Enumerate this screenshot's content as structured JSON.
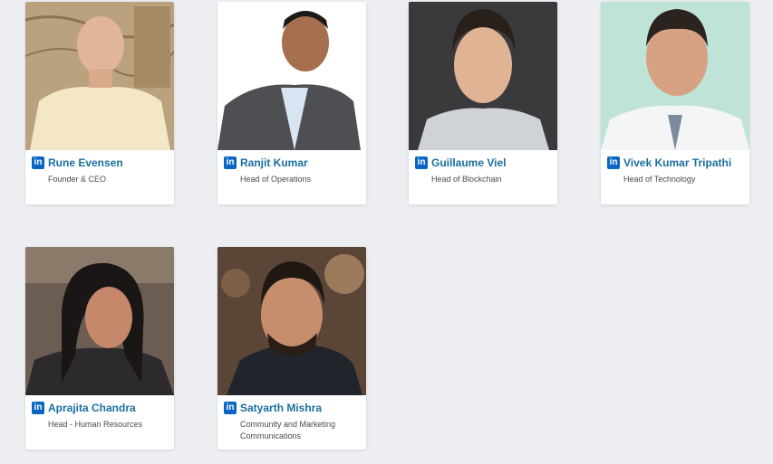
{
  "team": [
    {
      "name": "Rune Evensen",
      "role": "Founder & CEO",
      "linkedin_icon": "linkedin-icon"
    },
    {
      "name": "Ranjit Kumar",
      "role": "Head of Operations",
      "linkedin_icon": "linkedin-icon"
    },
    {
      "name": "Guillaume Viel",
      "role": "Head of Blockchain",
      "linkedin_icon": "linkedin-icon"
    },
    {
      "name": "Vivek Kumar Tripathi",
      "role": "Head of Technology",
      "linkedin_icon": "linkedin-icon"
    },
    {
      "name": "Aprajita Chandra",
      "role": "Head - Human Resources",
      "linkedin_icon": "linkedin-icon"
    },
    {
      "name": "Satyarth Mishra",
      "role": "Community and Marketing Communications",
      "linkedin_icon": "linkedin-icon"
    }
  ],
  "linkedin_label": "in",
  "colors": {
    "background": "#eceef2",
    "name_link": "#1a6ea0",
    "linkedin_blue": "#0a66c2"
  }
}
